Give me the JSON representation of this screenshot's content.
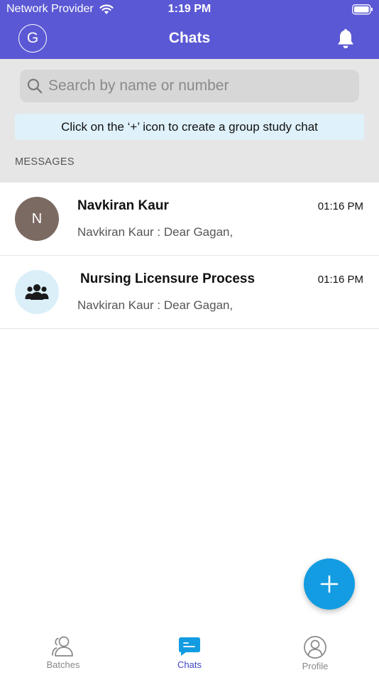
{
  "status_bar": {
    "carrier": "Network Provider",
    "time": "1:19 PM"
  },
  "header": {
    "avatar_letter": "G",
    "title": "Chats"
  },
  "search": {
    "placeholder": "Search by name or number"
  },
  "hint": {
    "text": "Click on the ‘+’ icon to create a group study chat"
  },
  "section_label": "MESSAGES",
  "chats": [
    {
      "avatar_letter": "N",
      "name": "Navkiran Kaur",
      "time": "01:16 PM",
      "preview": "Navkiran Kaur : Dear Gagan,"
    },
    {
      "avatar_icon": "group-icon",
      "name": "Nursing Licensure Process",
      "time": "01:16 PM",
      "preview": "Navkiran Kaur : Dear Gagan,"
    }
  ],
  "fab": {
    "icon": "plus-icon"
  },
  "tabs": [
    {
      "label": "Batches",
      "icon": "batches-icon",
      "active": false
    },
    {
      "label": "Chats",
      "icon": "chats-icon",
      "active": true
    },
    {
      "label": "Profile",
      "icon": "profile-icon",
      "active": false
    }
  ],
  "colors": {
    "header": "#5a58d4",
    "accent": "#139ce1",
    "active_tab": "#3b47c4"
  }
}
